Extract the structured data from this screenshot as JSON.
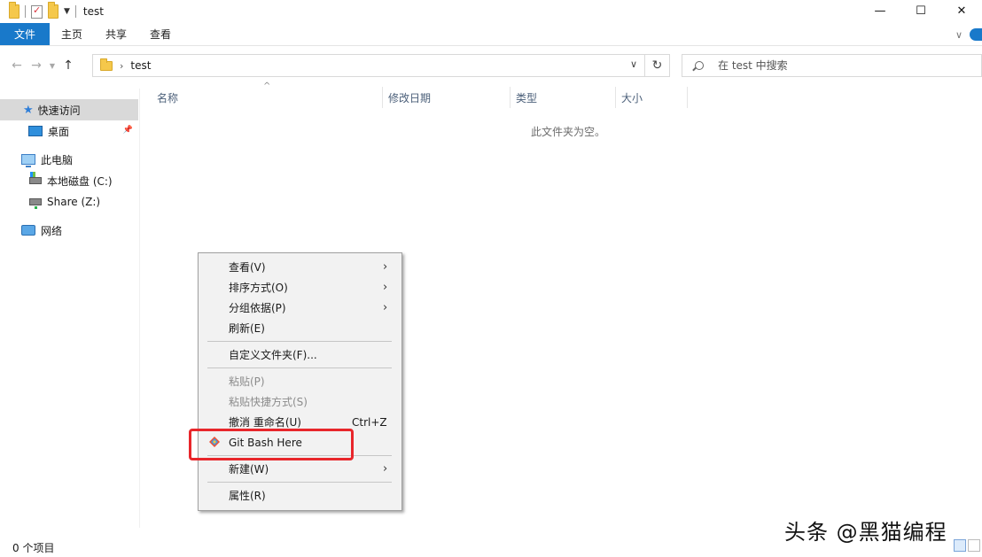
{
  "titlebar": {
    "title": "test",
    "minimize": "—",
    "maximize": "☐",
    "close": "✕"
  },
  "ribbon": {
    "tabs": [
      "文件",
      "主页",
      "共享",
      "查看"
    ]
  },
  "address": {
    "path": "test",
    "search_placeholder": "在 test 中搜索"
  },
  "nav": {
    "quick_access": "快速访问",
    "desktop": "桌面",
    "this_pc": "此电脑",
    "local_disk": "本地磁盘 (C:)",
    "share": "Share (Z:)",
    "network": "网络"
  },
  "columns": [
    "名称",
    "修改日期",
    "类型",
    "大小"
  ],
  "empty_message": "此文件夹为空。",
  "context_menu": {
    "view": "查看(V)",
    "sort": "排序方式(O)",
    "group": "分组依据(P)",
    "refresh": "刷新(E)",
    "customize": "自定义文件夹(F)...",
    "paste": "粘贴(P)",
    "paste_shortcut": "粘贴快捷方式(S)",
    "undo": "撤消 重命名(U)",
    "undo_shortcut": "Ctrl+Z",
    "git_bash": "Git Bash Here",
    "new": "新建(W)",
    "properties": "属性(R)"
  },
  "status": {
    "items": "0 个项目"
  },
  "watermark": "头条 @黑猫编程",
  "colors": {
    "accent": "#1979ca",
    "highlight": "#e8262b"
  }
}
